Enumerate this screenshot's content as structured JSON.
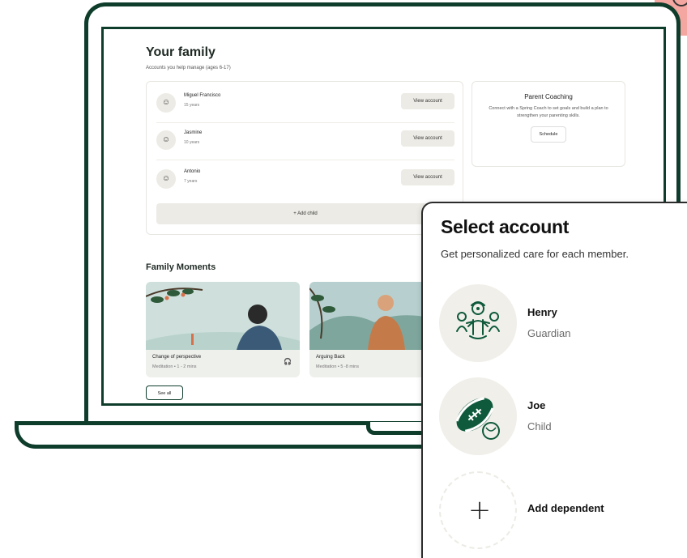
{
  "family": {
    "title": "Your family",
    "subtitle": "Accounts you help manage (ages 6-17)",
    "children": [
      {
        "name": "Miguel Francisco",
        "age": "15 years",
        "action": "View account"
      },
      {
        "name": "Jasmine",
        "age": "10 years",
        "action": "View account"
      },
      {
        "name": "Antonio",
        "age": "7 years",
        "action": "View account"
      }
    ],
    "add_child": "+ Add child"
  },
  "coaching": {
    "title": "Parent Coaching",
    "body": "Connect with a Spring Coach to set goals and build a plan to strengthen your parenting skills.",
    "button": "Schedule"
  },
  "moments": {
    "title": "Family Moments",
    "items": [
      {
        "name": "Change of perspective",
        "meta": "Meditation • 1 - 2 mins"
      },
      {
        "name": "Arguing Back",
        "meta": "Meditation • 5 -8 mins"
      }
    ],
    "see_all": "See all"
  },
  "select_account": {
    "title": "Select account",
    "subtitle": "Get personalized care for each member.",
    "accounts": [
      {
        "name": "Henry",
        "role": "Guardian",
        "icon": "family-illustration-icon"
      },
      {
        "name": "Joe",
        "role": "Child",
        "icon": "football-illustration-icon"
      }
    ],
    "add_dependent": "Add dependent"
  },
  "colors": {
    "brand_green": "#0f3d2c",
    "accent_pink": "#f4a6a0",
    "avatar_bg": "#f0efea"
  }
}
